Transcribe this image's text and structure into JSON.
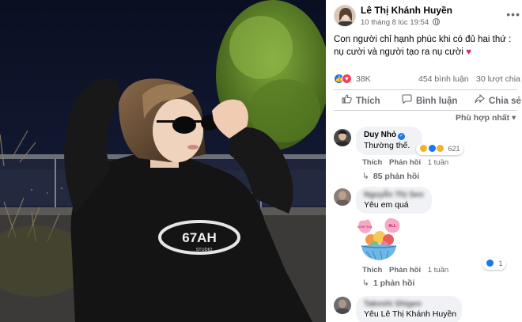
{
  "post": {
    "author": "Lê Thị Khánh Huyền",
    "time": "10 tháng 8 lúc 19:54",
    "caption": "Con người chỉ hạnh phúc khi có đủ hai thứ : nụ cười và người tạo ra nụ cười",
    "caption_emoji": "♥",
    "more_icon": "more-horizontal-icon",
    "photo_text": "67AH",
    "photo_text_sub": "STUDIO"
  },
  "stats": {
    "reactions": "38K",
    "comments": "454 bình luận",
    "shares": "30 lượt chia sẻ"
  },
  "actions": {
    "like": "Thích",
    "comment": "Bình luận",
    "share": "Chia sẻ"
  },
  "sort": {
    "label": "Phù hợp nhất",
    "caret": "▾"
  },
  "comments": [
    {
      "name": "Duy Nhỏ",
      "verified": true,
      "text": "Thường thế.",
      "reactions": "621",
      "like": "Thích",
      "reply": "Phản hồi",
      "age": "1 tuần",
      "replies": "85 phản hồi"
    },
    {
      "name": "Nguyễn Thị Sen",
      "text": "Yêu em quá",
      "sticker_text_1": "Love You",
      "sticker_text_2": "ALL",
      "reactions": "1",
      "like": "Thích",
      "reply": "Phản hồi",
      "age": "1 tuần",
      "replies": "1 phản hồi"
    },
    {
      "name": "Takeshi Shigeo",
      "text": "Yêu Lê Thị Khánh Huyền"
    }
  ],
  "colors": {
    "brand_blue": "#1877f2",
    "love_red": "#f33e58",
    "muted_text": "#65676b",
    "bubble_bg": "#f0f2f5"
  }
}
